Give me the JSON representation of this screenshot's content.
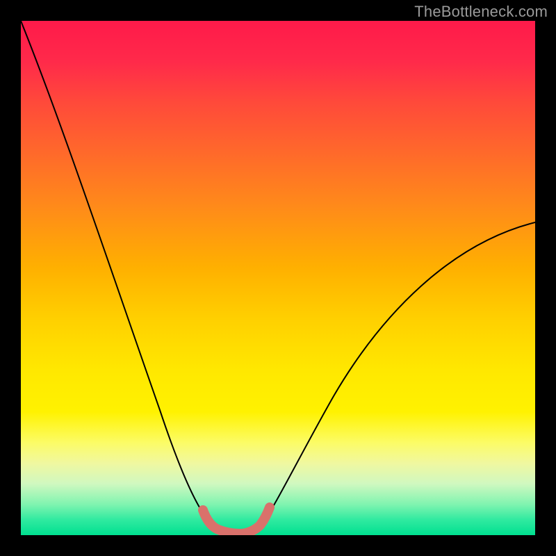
{
  "watermark": "TheBottleneck.com",
  "colors": {
    "frame": "#000000",
    "curve": "#000000",
    "highlight": "#d9716b"
  },
  "chart_data": {
    "type": "line",
    "title": "",
    "xlabel": "",
    "ylabel": "",
    "xlim": [
      0,
      100
    ],
    "ylim": [
      0,
      100
    ],
    "grid": false,
    "legend_position": "none",
    "series": [
      {
        "name": "bottleneck-curve",
        "x": [
          0,
          5,
          10,
          15,
          20,
          25,
          28,
          31,
          34,
          36,
          38,
          40,
          42,
          44,
          46,
          50,
          55,
          60,
          65,
          70,
          75,
          80,
          85,
          90,
          95,
          100
        ],
        "y": [
          100,
          86,
          72,
          58,
          44,
          30,
          21,
          13,
          7,
          4,
          2,
          1,
          1,
          2,
          4,
          8,
          14,
          21,
          28,
          34,
          40,
          46,
          51,
          55,
          58,
          61
        ]
      }
    ],
    "highlight_zone": {
      "x_range": [
        34,
        46
      ],
      "description": "optimal / no-bottleneck region at curve minimum"
    }
  }
}
